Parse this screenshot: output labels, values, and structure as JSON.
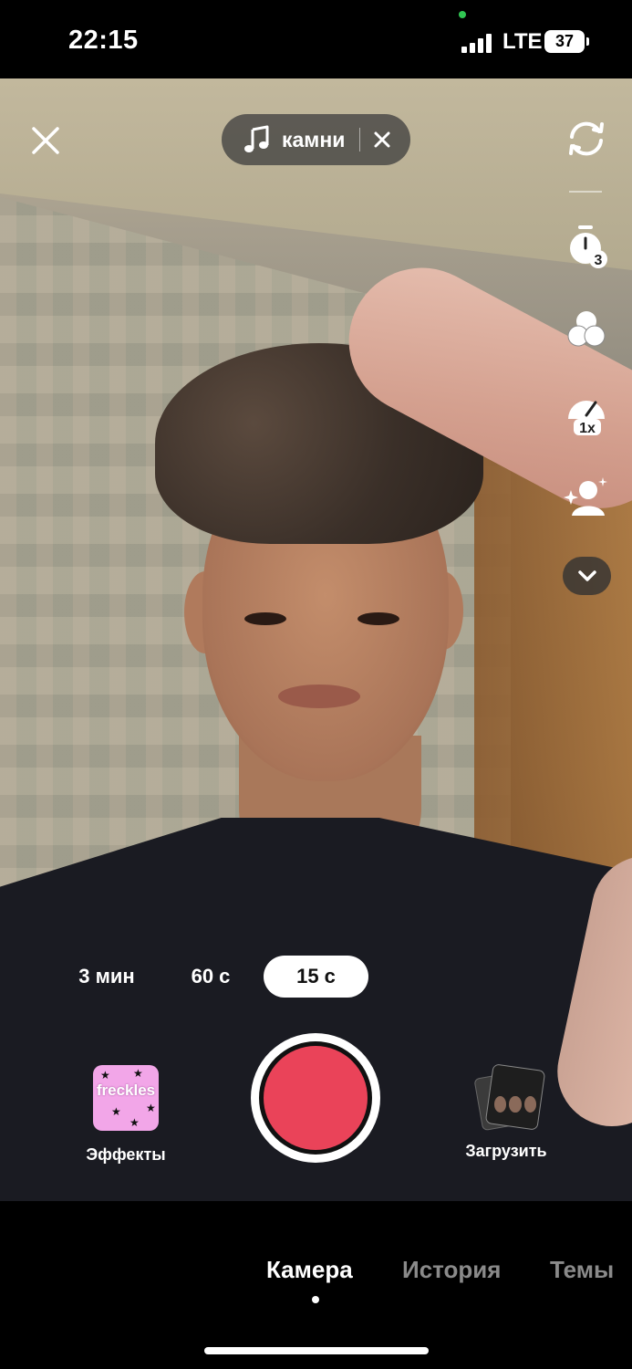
{
  "status_bar": {
    "time": "22:15",
    "network": "LTE",
    "battery": "37"
  },
  "top": {
    "close_icon": "close-icon",
    "sound": {
      "title": "камни",
      "icon": "music-note-icon"
    }
  },
  "right_tools": [
    {
      "name": "flip-camera-icon"
    },
    {
      "name": "timer-icon",
      "badge": "3"
    },
    {
      "name": "filters-icon"
    },
    {
      "name": "speed-icon",
      "badge": "1x"
    },
    {
      "name": "beautify-icon"
    },
    {
      "name": "chevron-down-icon"
    }
  ],
  "durations": [
    {
      "label": "3 мин",
      "active": false
    },
    {
      "label": "60 с",
      "active": false
    },
    {
      "label": "15 с",
      "active": true
    }
  ],
  "effects": {
    "thumb_text": "freckles",
    "label": "Эффекты",
    "color": "#f2a6e8"
  },
  "record": {
    "color": "#ea4359"
  },
  "upload": {
    "label": "Загрузить"
  },
  "tabs": [
    {
      "label": "Камера",
      "active": true
    },
    {
      "label": "История",
      "active": false
    },
    {
      "label": "Темы",
      "active": false
    }
  ]
}
